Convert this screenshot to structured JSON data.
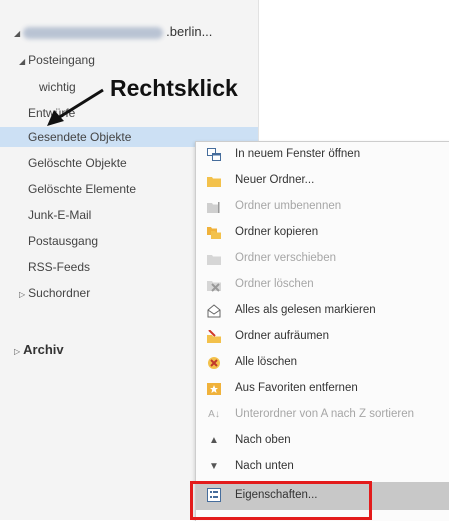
{
  "account": {
    "name_suffix": ".berlin..."
  },
  "folders": [
    {
      "label": "Posteingang"
    },
    {
      "label": "wichtig"
    },
    {
      "label": "Entwürfe"
    },
    {
      "label": "Gesendete Objekte"
    },
    {
      "label": "Gelöschte Objekte"
    },
    {
      "label": "Gelöschte Elemente"
    },
    {
      "label": "Junk-E-Mail"
    },
    {
      "label": "Postausgang"
    },
    {
      "label": "RSS-Feeds"
    },
    {
      "label": "Suchordner"
    }
  ],
  "archive": {
    "label": "Archiv"
  },
  "annotation": {
    "text": "Rechtsklick"
  },
  "context_menu": {
    "items": [
      {
        "label": "In neuem Fenster öffnen",
        "enabled": true,
        "icon": "window-icon"
      },
      {
        "label": "Neuer Ordner...",
        "enabled": true,
        "icon": "new-folder-icon"
      },
      {
        "label": "Ordner umbenennen",
        "enabled": false,
        "icon": "rename-icon"
      },
      {
        "label": "Ordner kopieren",
        "enabled": true,
        "icon": "copy-folder-icon"
      },
      {
        "label": "Ordner verschieben",
        "enabled": false,
        "icon": "move-folder-icon"
      },
      {
        "label": "Ordner löschen",
        "enabled": false,
        "icon": "delete-folder-icon"
      },
      {
        "label": "Alles als gelesen markieren",
        "enabled": true,
        "icon": "mark-read-icon"
      },
      {
        "label": "Ordner aufräumen",
        "enabled": true,
        "icon": "cleanup-icon"
      },
      {
        "label": "Alle löschen",
        "enabled": true,
        "icon": "delete-all-icon"
      },
      {
        "label": "Aus Favoriten entfernen",
        "enabled": true,
        "icon": "favorite-icon"
      },
      {
        "label": "Unterordner von A nach Z sortieren",
        "enabled": false,
        "icon": "sort-icon"
      },
      {
        "label": "Nach oben",
        "enabled": true,
        "icon": "up-arrow-icon"
      },
      {
        "label": "Nach unten",
        "enabled": true,
        "icon": "down-arrow-icon"
      },
      {
        "label": "Eigenschaften...",
        "enabled": true,
        "icon": "properties-icon",
        "highlighted": true
      }
    ]
  },
  "colors": {
    "selected_folder": "#cce0f4",
    "highlight_box": "#e31b1b",
    "menu_hover": "#c8c8c8"
  }
}
